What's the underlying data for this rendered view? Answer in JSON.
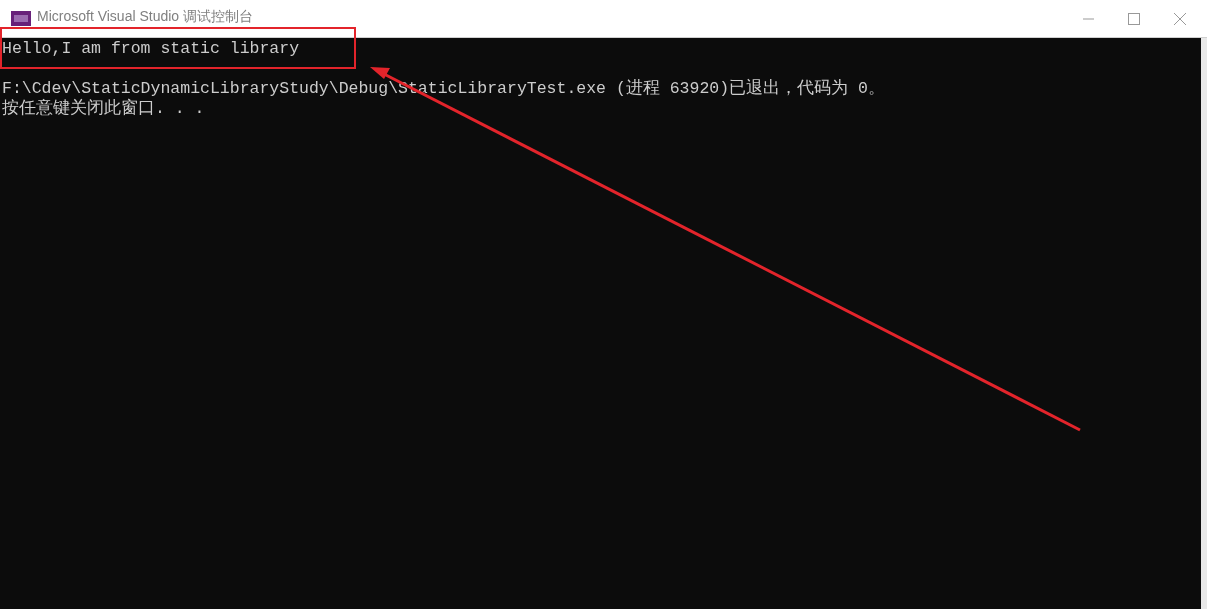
{
  "window": {
    "title": "Microsoft Visual Studio 调试控制台"
  },
  "console": {
    "lines": [
      "Hello,I am from static library",
      "F:\\Cdev\\StaticDynamicLibraryStudy\\Debug\\StaticLibraryTest.exe (进程 63920)已退出，代码为 0。",
      "按任意键关闭此窗口. . ."
    ]
  }
}
